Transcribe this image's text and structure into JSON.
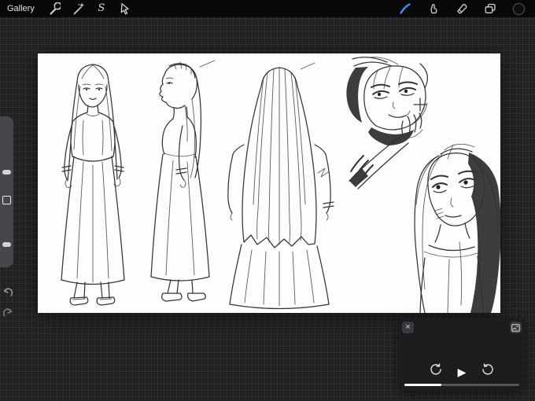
{
  "toolbar": {
    "gallery_label": "Gallery",
    "left_tools": [
      {
        "id": "actions",
        "icon": "wrench-icon"
      },
      {
        "id": "adjustments",
        "icon": "magic-wand-icon"
      },
      {
        "id": "selection",
        "icon": "s-letter-glyph",
        "label": "S"
      },
      {
        "id": "transform",
        "icon": "cursor-arrow-icon"
      }
    ],
    "right_tools": [
      {
        "id": "paint",
        "icon": "brush-stroke-icon",
        "active": true,
        "active_color": "#3e8df3"
      },
      {
        "id": "smudge",
        "icon": "smudge-finger-icon"
      },
      {
        "id": "erase",
        "icon": "eraser-icon"
      },
      {
        "id": "layers",
        "icon": "layers-icon"
      },
      {
        "id": "color",
        "icon": "color-swatch-circle",
        "current_color": "#0f0f12"
      }
    ]
  },
  "sidebar": {
    "controls": [
      {
        "id": "brush-size",
        "type": "slider"
      },
      {
        "id": "modify",
        "type": "button"
      },
      {
        "id": "opacity",
        "type": "slider"
      },
      {
        "id": "undo",
        "icon": "undo-arrow-icon"
      },
      {
        "id": "redo",
        "icon": "redo-arrow-icon"
      }
    ]
  },
  "canvas": {
    "background_color": "#fdfdfd",
    "artwork_description": "graphite character design sketches: standing front view, side profile with braid, back view, and two portrait studies of a long-haired girl"
  },
  "video_panel": {
    "close_glyph": "×",
    "play_glyph": "▶",
    "progress_percent": 32,
    "icons": [
      "photo-export-icon",
      "replay-back-icon",
      "play-icon",
      "replay-forward-icon"
    ]
  }
}
